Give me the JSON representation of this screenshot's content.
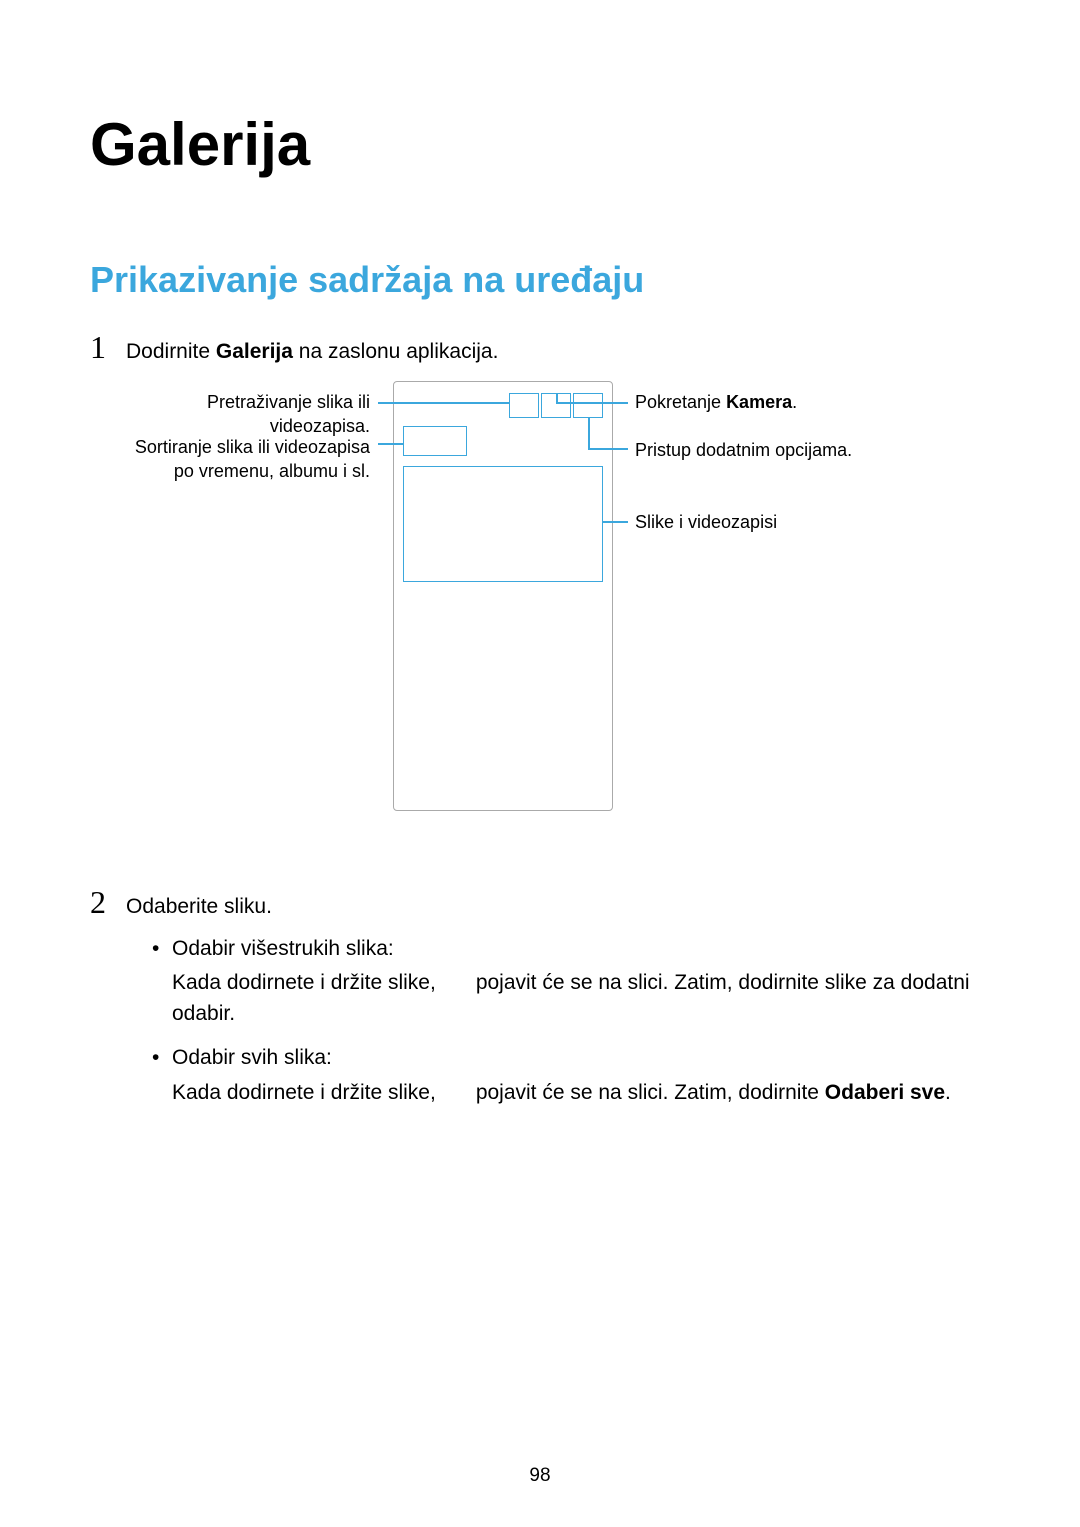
{
  "title": "Galerija",
  "subtitle": "Prikazivanje sadržaja na uređaju",
  "step1": {
    "num": "1",
    "pre": "Dodirnite ",
    "bold": "Galerija",
    "post": " na zaslonu aplikacija."
  },
  "diagram": {
    "left1": "Pretraživanje slika ili videozapisa.",
    "left2": "Sortiranje slika ili videozapisa po vremenu, albumu i sl.",
    "right1_pre": "Pokretanje ",
    "right1_bold": "Kamera",
    "right1_post": ".",
    "right2": "Pristup dodatnim opcijama.",
    "right3": "Slike i videozapisi"
  },
  "step2": {
    "num": "2",
    "text": "Odaberite sliku."
  },
  "bullets": {
    "b1_head": "Odabir višestrukih slika:",
    "b1_body_a": "Kada dodirnete i držite slike,",
    "b1_body_b": "pojavit će se na slici. Zatim, dodirnite slike za dodatni odabir.",
    "b2_head": "Odabir svih slika:",
    "b2_body_a": "Kada dodirnete i držite slike,",
    "b2_body_b_pre": "pojavit će se na slici. Zatim, dodirnite ",
    "b2_body_b_bold": "Odaberi sve",
    "b2_body_b_post": "."
  },
  "pagenum": "98"
}
